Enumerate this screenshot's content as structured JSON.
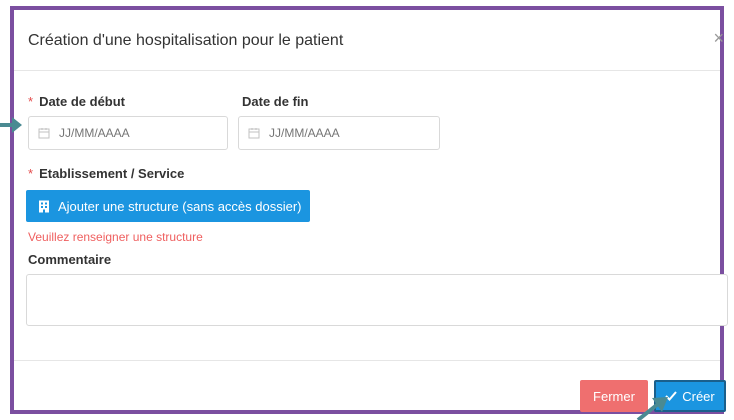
{
  "modal": {
    "title": "Création d'une hospitalisation pour le patient",
    "close_glyph": "×"
  },
  "form": {
    "start_date": {
      "required_mark": "*",
      "label": "Date de début",
      "placeholder": "JJ/MM/AAAA"
    },
    "end_date": {
      "label": "Date de fin",
      "placeholder": "JJ/MM/AAAA"
    },
    "establishment": {
      "required_mark": "*",
      "label": "Etablissement / Service",
      "add_button_label": "Ajouter une structure (sans accès dossier)",
      "error_message": "Veuillez renseigner une structure"
    },
    "comment": {
      "label": "Commentaire",
      "value": ""
    }
  },
  "footer": {
    "close_label": "Fermer",
    "create_label": "Créer"
  },
  "colors": {
    "frame": "#7b4fa0",
    "primary": "#1b95e0",
    "danger": "#ef6f6f",
    "required": "#e34b4b",
    "annotation_arrow": "#4a8a92"
  },
  "icons": [
    "calendar-icon",
    "building-icon",
    "check-icon",
    "close-icon",
    "arrow-pointer"
  ]
}
